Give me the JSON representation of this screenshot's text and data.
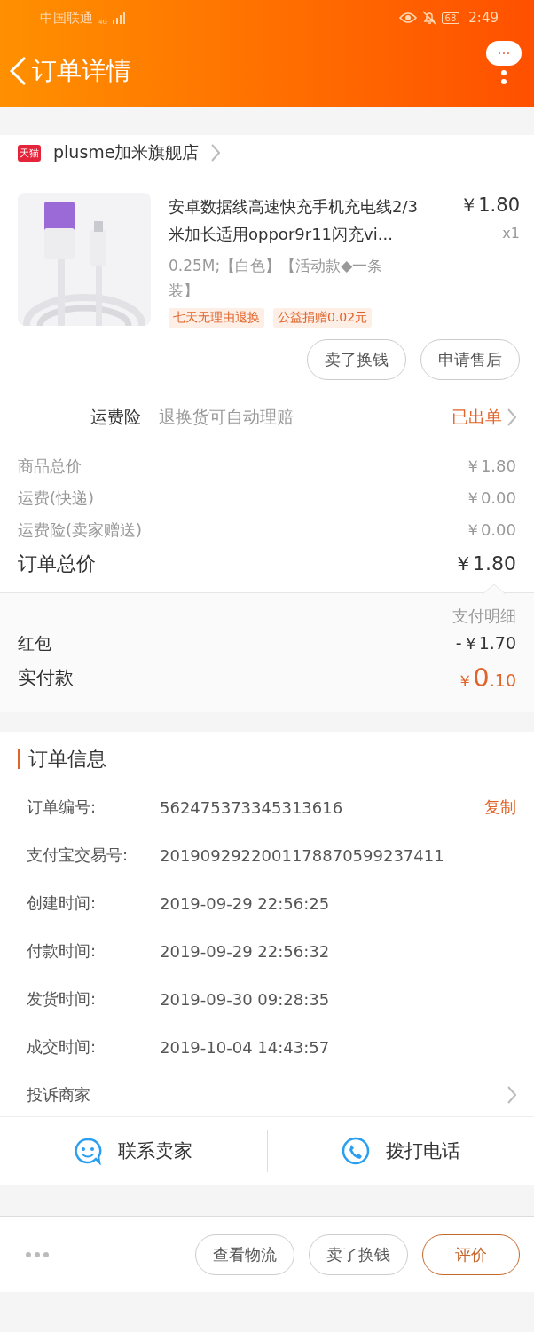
{
  "status_bar": {
    "carrier": "中国联通",
    "network": "4G",
    "battery": "68",
    "time": "2:49"
  },
  "header": {
    "title": "订单详情"
  },
  "shop": {
    "name": "plusme加米旗舰店",
    "badge": "天猫"
  },
  "product": {
    "title": "安卓数据线高速快充手机充电线2/3米加长适用oppor9r11闪充vi...",
    "price": "￥1.80",
    "quantity": "x1",
    "sku": "0.25M;【白色】【活动款◆一条装】",
    "tags": [
      "七天无理由退换",
      "公益捐赠0.02元"
    ],
    "actions": [
      "卖了换钱",
      "申请售后"
    ]
  },
  "insurance": {
    "label": "运费险",
    "description": "退换货可自动理赔",
    "status": "已出单"
  },
  "costs": [
    {
      "label": "商品总价",
      "value": "￥1.80"
    },
    {
      "label": "运费(快递)",
      "value": "￥0.00"
    },
    {
      "label": "运费险(卖家赠送)",
      "value": "￥0.00"
    }
  ],
  "total": {
    "label": "订单总价",
    "value": "￥1.80"
  },
  "payment": {
    "title": "支付明细",
    "discount_label": "红包",
    "discount_value": "-￥1.70",
    "paid_label": "实付款",
    "paid_currency": "￥",
    "paid_integer": "0",
    "paid_decimal": ".10"
  },
  "order_info": {
    "title": "订单信息",
    "rows": [
      {
        "label": "订单编号:",
        "value": "562475373345313616",
        "action": "复制"
      },
      {
        "label": "支付宝交易号:",
        "value": "2019092922001178870599237411"
      },
      {
        "label": "创建时间:",
        "value": "2019-09-29 22:56:25"
      },
      {
        "label": "付款时间:",
        "value": "2019-09-29 22:56:32"
      },
      {
        "label": "发货时间:",
        "value": "2019-09-30 09:28:35"
      },
      {
        "label": "成交时间:",
        "value": "2019-10-04 14:43:57"
      }
    ],
    "complaint": "投诉商家"
  },
  "contact": [
    {
      "kind": "chat",
      "label": "联系卖家"
    },
    {
      "kind": "phone",
      "label": "拨打电话"
    }
  ],
  "bottom_actions": [
    {
      "label": "查看物流",
      "primary": false
    },
    {
      "label": "卖了换钱",
      "primary": false
    },
    {
      "label": "评价",
      "primary": true
    }
  ]
}
